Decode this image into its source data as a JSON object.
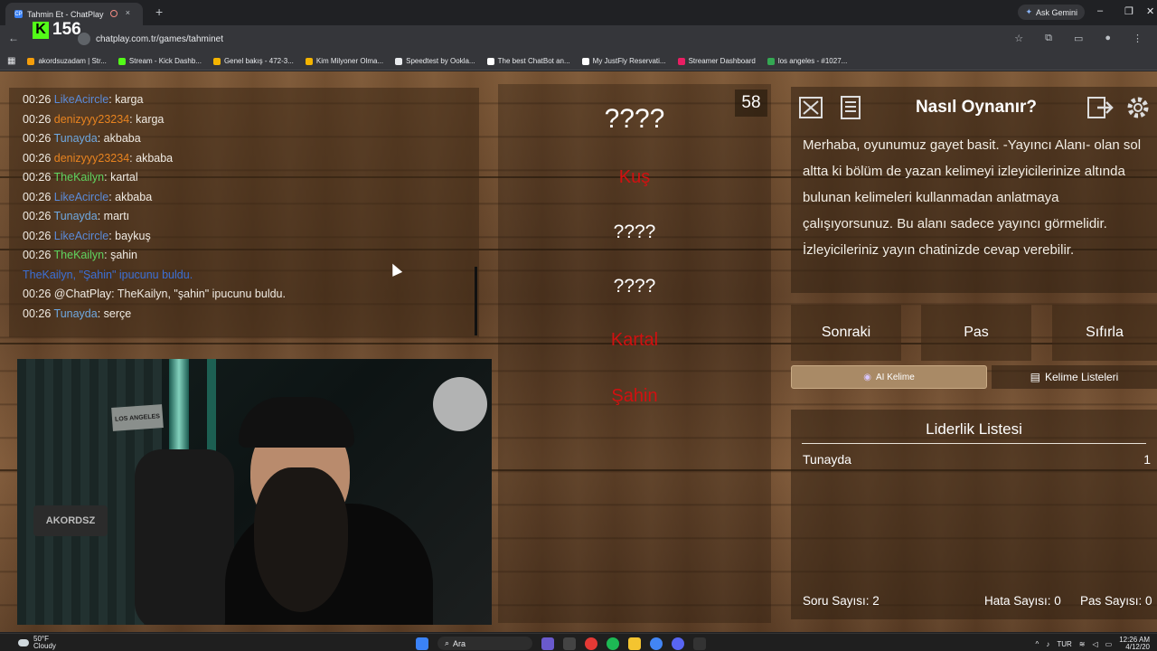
{
  "browser": {
    "tab_title": "Tahmin Et - ChatPlay",
    "tab_close": "×",
    "tab_favicon": "CP",
    "new_tab": "+",
    "gemini_label": "Ask Gemini",
    "url": "chatplay.com.tr/games/tahminet",
    "back": "←",
    "window_controls": [
      "–",
      "❐",
      "✕"
    ],
    "bookmarks": [
      {
        "label": "akordsuzadam | Str...",
        "color": "#f59e0b"
      },
      {
        "label": "Stream - Kick Dashb...",
        "color": "#53fc18"
      },
      {
        "label": "Genel bakış - 472-3...",
        "color": "#f4b400"
      },
      {
        "label": "Kim Milyoner Olma...",
        "color": "#f4b400"
      },
      {
        "label": "Speedtest by Ookla...",
        "color": "#e8eaed"
      },
      {
        "label": "The best ChatBot an...",
        "color": "#ffffff"
      },
      {
        "label": "My JustFly Reservati...",
        "color": "#ffffff"
      },
      {
        "label": "Streamer Dashboard",
        "color": "#e91e63"
      },
      {
        "label": "los angeles - #1027...",
        "color": "#34a853"
      }
    ]
  },
  "overlay": {
    "kick_logo": "K",
    "viewer_count": "156"
  },
  "chat": {
    "colors": {
      "LikeAcircle": "#5b8bd9",
      "denizyyy23234": "#e8831f",
      "Tunayda": "#6fa8e0",
      "TheKailyn": "#5fd35f",
      "system": "#3b6fd6"
    },
    "messages": [
      {
        "time": "00:26",
        "user": "LikeAcircle",
        "text": ": karga"
      },
      {
        "time": "00:26",
        "user": "denizyyy23234",
        "text": ": karga"
      },
      {
        "time": "00:26",
        "user": "Tunayda",
        "text": ": akbaba"
      },
      {
        "time": "00:26",
        "user": "denizyyy23234",
        "text": ": akbaba"
      },
      {
        "time": "00:26",
        "user": "TheKailyn",
        "text": ": kartal"
      },
      {
        "time": "00:26",
        "user": "LikeAcircle",
        "text": ": akbaba"
      },
      {
        "time": "00:26",
        "user": "Tunayda",
        "text": ": martı"
      },
      {
        "time": "00:26",
        "user": "LikeAcircle",
        "text": ": baykuş"
      },
      {
        "time": "00:26",
        "user": "TheKailyn",
        "text": ": şahin"
      },
      {
        "time": "",
        "user": "",
        "text": "TheKailyn, \"Şahin\" ipucunu buldu."
      },
      {
        "time": "00:26",
        "user": "",
        "text": "@ChatPlay: TheKailyn, \"şahin\" ipucunu buldu."
      },
      {
        "time": "00:26",
        "user": "Tunayda",
        "text": ": serçe"
      }
    ]
  },
  "webcam": {
    "sign_top": "LOS ANGELES",
    "sign_desk": "AKORDSZ"
  },
  "game": {
    "timer": "58",
    "words": [
      {
        "text": "????",
        "state": "hidden-main"
      },
      {
        "text": "Kuş",
        "state": "found"
      },
      {
        "text": "????",
        "state": "hidden"
      },
      {
        "text": "????",
        "state": "hidden"
      },
      {
        "text": "Kartal",
        "state": "found"
      },
      {
        "text": "Şahin",
        "state": "found"
      }
    ]
  },
  "howto": {
    "title": "Nasıl Oynanır?",
    "text": "Merhaba, oyunumuz gayet basit. -Yayıncı Alanı- olan sol altta ki bölüm de yazan kelimeyi izleyicilerinize altında bulunan kelimeleri kullanmadan anlatmaya çalışıyorsunuz. Bu alanı sadece yayıncı görmelidir. İzleyicileriniz yayın chatinizde cevap verebilir."
  },
  "controls": {
    "next": "Sonraki",
    "pass": "Pas",
    "reset": "Sıfırla",
    "tab_ai": "AI Kelime",
    "tab_lists": "Kelime Listeleri"
  },
  "leaderboard": {
    "title": "Liderlik Listesi",
    "rows": [
      {
        "name": "Tunayda",
        "score": "1"
      }
    ],
    "questions": "Soru Sayısı: 2",
    "errors": "Hata Sayısı: 0",
    "passes": "Pas Sayısı: 0"
  },
  "taskbar": {
    "temp": "50°F",
    "weather": "Cloudy",
    "search": "Ara",
    "lang": "TUR",
    "time": "12:26 AM",
    "date": "4/12/20"
  }
}
